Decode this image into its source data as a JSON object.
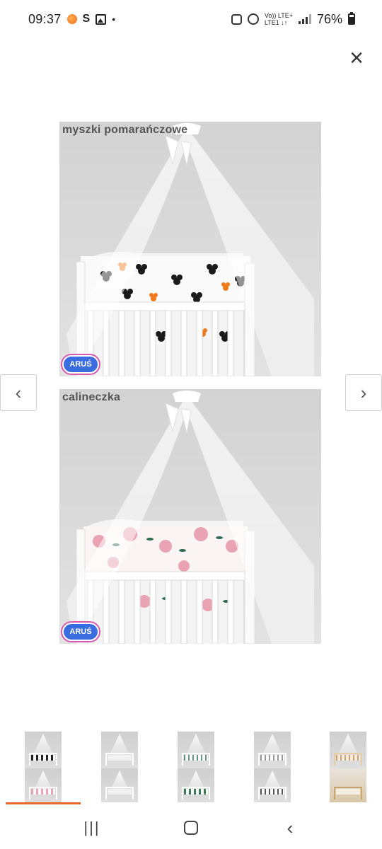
{
  "status_bar": {
    "time": "09:37",
    "s_label": "S",
    "dot": "•",
    "net_line1": "Vo)) LTE+",
    "net_line2": "LTE1 ↓↑",
    "battery": "76%"
  },
  "viewer": {
    "close_icon": "×",
    "prev_icon": "‹",
    "next_icon": "›",
    "images": [
      {
        "caption": "myszki pomarańczowe",
        "logo": "ARUŚ",
        "pattern": "mice"
      },
      {
        "caption": "calineczka",
        "logo": "ARUŚ",
        "pattern": "flowers"
      }
    ]
  },
  "thumbnails": [
    {
      "pattern": "mice"
    },
    {
      "pattern": "white"
    },
    {
      "pattern": "dots"
    },
    {
      "pattern": "stars"
    },
    {
      "pattern": "wood-light"
    },
    {
      "pattern": "flowers"
    },
    {
      "pattern": "white"
    },
    {
      "pattern": "leaves"
    },
    {
      "pattern": "mice-grey"
    },
    {
      "pattern": "wood"
    }
  ],
  "colors": {
    "accent": "#e8682b",
    "logo_blue": "#3a6ee0",
    "mouse_orange": "#f07a1a",
    "flower_pink": "#e9a3b3"
  },
  "nav_bar": {
    "recent_icon": "|||",
    "back_icon": "‹"
  }
}
